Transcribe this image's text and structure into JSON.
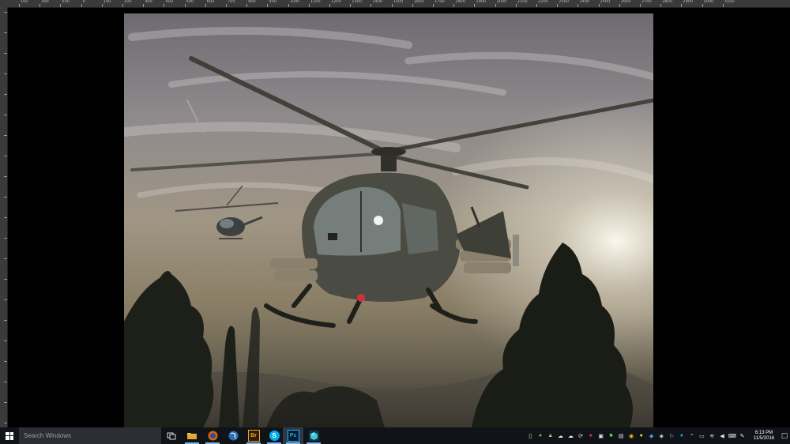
{
  "ruler": {
    "top_labels": [
      "100",
      "300",
      "500",
      "0",
      "100",
      "200",
      "300",
      "400",
      "500",
      "600",
      "700",
      "800",
      "900",
      "1000",
      "1100",
      "1200",
      "1300",
      "1400",
      "1500",
      "1600",
      "1700",
      "1800",
      "1900",
      "2000",
      "2100",
      "2200",
      "2300",
      "2400",
      "2500",
      "2600",
      "2700",
      "2800",
      "2900",
      "3000",
      "3100"
    ]
  },
  "taskbar": {
    "search_placeholder": "Search Windows",
    "apps": [
      {
        "name": "task-view",
        "icon": "task-view-icon"
      },
      {
        "name": "file-explorer",
        "icon": "folder-icon"
      },
      {
        "name": "firefox",
        "icon": "firefox-icon"
      },
      {
        "name": "app-globe",
        "icon": "globe-icon"
      },
      {
        "name": "adobe-bridge",
        "icon": "bridge-icon",
        "label": "Br"
      },
      {
        "name": "skype",
        "icon": "skype-icon",
        "label": "S"
      },
      {
        "name": "photoshop",
        "icon": "photoshop-icon",
        "label": "Ps"
      },
      {
        "name": "app-3d",
        "icon": "cube-icon"
      }
    ],
    "clock": {
      "time": "6:13 PM",
      "date": "11/5/2016"
    }
  },
  "colors": {
    "taskbar_bg": "#101418",
    "ruler_bg": "#3a3a3a",
    "photoshop_blue": "#31a8ff",
    "bridge_orange": "#f5a623"
  }
}
